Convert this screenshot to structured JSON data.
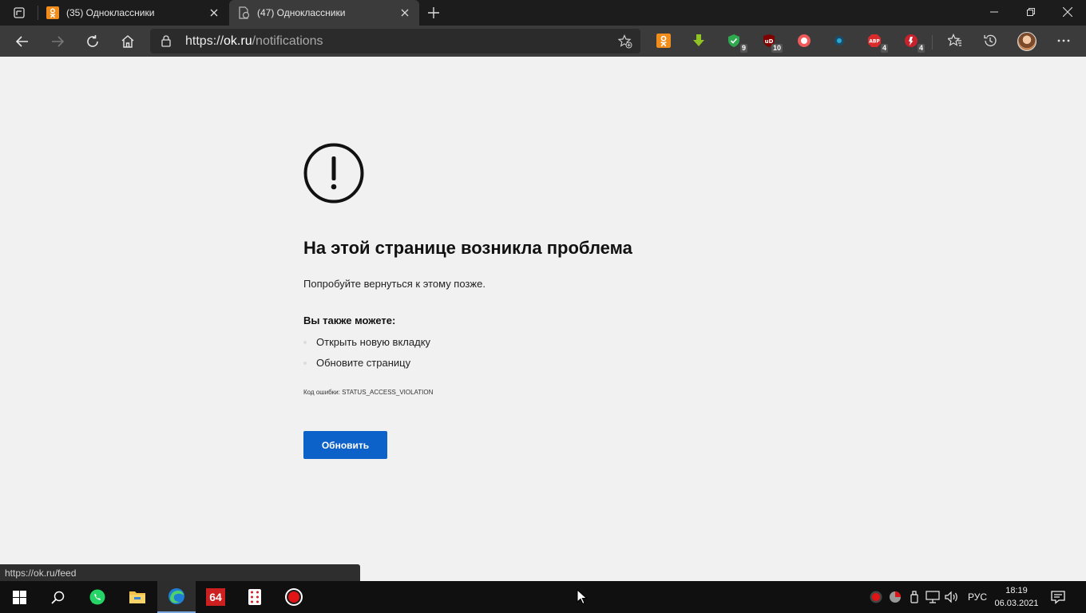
{
  "tabs": [
    {
      "title": "(35) Одноклассники",
      "state": "inactive"
    },
    {
      "title": "(47) Одноклассники",
      "state": "active"
    }
  ],
  "address": {
    "scheme": "https://",
    "host": "ok.ru",
    "path": "/notifications"
  },
  "extension_badges": {
    "shield": "9",
    "ublock": "10",
    "adblock": "4",
    "ext_red": "4"
  },
  "page": {
    "heading": "На этой странице возникла проблема",
    "subtext": "Попробуйте вернуться к этому позже.",
    "also_label": "Вы также можете:",
    "suggestions": [
      "Открыть новую вкладку",
      "Обновите страницу"
    ],
    "error_code": "Код ошибки: STATUS_ACCESS_VIOLATION",
    "refresh_label": "Обновить"
  },
  "status_url": "https://ok.ru/feed",
  "taskbar": {
    "lang": "РУС",
    "time": "18:19",
    "date": "06.03.2021",
    "app_badge": "64"
  },
  "colors": {
    "accent": "#0c62c9",
    "ok_orange": "#f28c1b"
  }
}
